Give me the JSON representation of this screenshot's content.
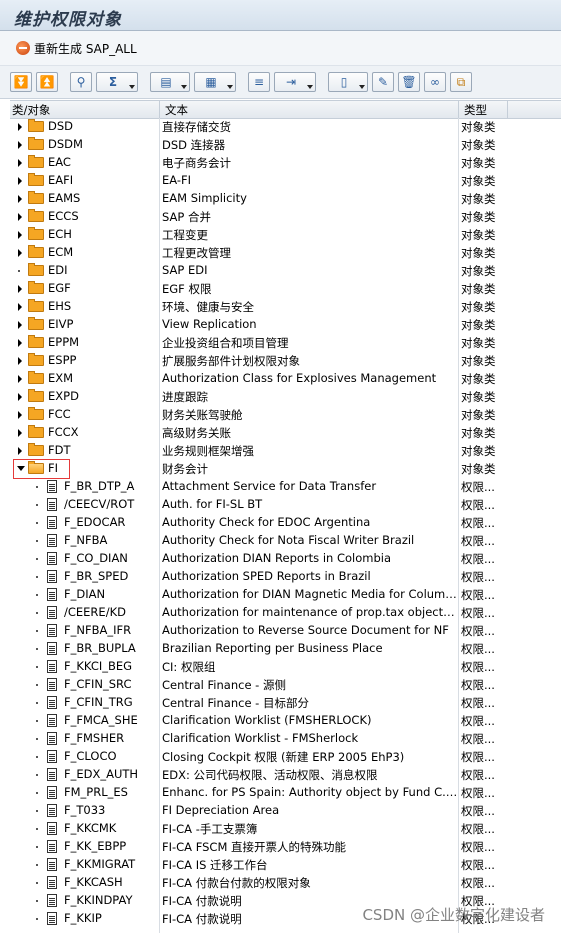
{
  "window": {
    "title": "维护权限对象"
  },
  "app_toolbar": {
    "regenerate_label": "重新生成 SAP_ALL"
  },
  "columns": {
    "object": "类/对象",
    "text": "文本",
    "type": "类型"
  },
  "tree": {
    "classes": [
      {
        "name": "DSD",
        "text": "直接存储交货",
        "type": "对象类",
        "leaf": false
      },
      {
        "name": "DSDM",
        "text": "DSD 连接器",
        "type": "对象类",
        "leaf": false
      },
      {
        "name": "EAC",
        "text": "电子商务会计",
        "type": "对象类",
        "leaf": false
      },
      {
        "name": "EAFI",
        "text": "EA-FI",
        "type": "对象类",
        "leaf": false
      },
      {
        "name": "EAMS",
        "text": "EAM Simplicity",
        "type": "对象类",
        "leaf": false
      },
      {
        "name": "ECCS",
        "text": "SAP 合并",
        "type": "对象类",
        "leaf": false
      },
      {
        "name": "ECH",
        "text": "工程变更",
        "type": "对象类",
        "leaf": false
      },
      {
        "name": "ECM",
        "text": "工程更改管理",
        "type": "对象类",
        "leaf": false
      },
      {
        "name": "EDI",
        "text": "SAP EDI",
        "type": "对象类",
        "leaf": true
      },
      {
        "name": "EGF",
        "text": "EGF 权限",
        "type": "对象类",
        "leaf": false
      },
      {
        "name": "EHS",
        "text": "环境、健康与安全",
        "type": "对象类",
        "leaf": false
      },
      {
        "name": "EIVP",
        "text": "View Replication",
        "type": "对象类",
        "leaf": false
      },
      {
        "name": "EPPM",
        "text": "企业投资组合和项目管理",
        "type": "对象类",
        "leaf": false
      },
      {
        "name": "ESPP",
        "text": "扩展服务部件计划权限对象",
        "type": "对象类",
        "leaf": false
      },
      {
        "name": "EXM",
        "text": "Authorization Class for Explosives Management",
        "type": "对象类",
        "leaf": false
      },
      {
        "name": "EXPD",
        "text": "进度跟踪",
        "type": "对象类",
        "leaf": false
      },
      {
        "name": "FCC",
        "text": "财务关账驾驶舱",
        "type": "对象类",
        "leaf": false
      },
      {
        "name": "FCCX",
        "text": "高级财务关账",
        "type": "对象类",
        "leaf": false
      },
      {
        "name": "FDT",
        "text": "业务规则框架增强",
        "type": "对象类",
        "leaf": false
      },
      {
        "name": "FI",
        "text": "财务会计",
        "type": "对象类",
        "leaf": false,
        "expanded": true
      }
    ],
    "fi_objects": [
      {
        "name": "F_BR_DTP_A",
        "text": "Attachment Service for Data Transfer",
        "type": "权限..."
      },
      {
        "name": "/CEECV/ROT",
        "text": "Auth. for FI-SL BT",
        "type": "权限..."
      },
      {
        "name": "F_EDOCAR",
        "text": "Authority Check for EDOC Argentina",
        "type": "权限..."
      },
      {
        "name": "F_NFBA",
        "text": "Authority Check for Nota Fiscal Writer Brazil",
        "type": "权限..."
      },
      {
        "name": "F_CO_DIAN",
        "text": "Authorization DIAN Reports in Colombia",
        "type": "权限..."
      },
      {
        "name": "F_BR_SPED",
        "text": "Authorization SPED Reports in Brazil",
        "type": "权限..."
      },
      {
        "name": "F_DIAN",
        "text": "Authorization for DIAN Magnetic Media for Columbia",
        "type": "权限..."
      },
      {
        "name": "/CEERE/KD",
        "text": "Authorization for maintenance of prop.tax object m...",
        "type": "权限..."
      },
      {
        "name": "F_NFBA_IFR",
        "text": "Authorization to Reverse Source Document for NF",
        "type": "权限..."
      },
      {
        "name": "F_BR_BUPLA",
        "text": "Brazilian Reporting per Business Place",
        "type": "权限..."
      },
      {
        "name": "F_KKCI_BEG",
        "text": "CI: 权限组",
        "type": "权限..."
      },
      {
        "name": "F_CFIN_SRC",
        "text": "Central Finance - 源侧",
        "type": "权限..."
      },
      {
        "name": "F_CFIN_TRG",
        "text": "Central Finance - 目标部分",
        "type": "权限..."
      },
      {
        "name": "F_FMCA_SHE",
        "text": "Clarification Worklist (FMSHERLOCK)",
        "type": "权限..."
      },
      {
        "name": "F_FMSHER",
        "text": "Clarification Worklist - FMSherlock",
        "type": "权限..."
      },
      {
        "name": "F_CLOCO",
        "text": "Closing Cockpit 权限 (新建 ERP 2005 EhP3)",
        "type": "权限..."
      },
      {
        "name": "F_EDX_AUTH",
        "text": "EDX: 公司代码权限、活动权限、消息权限",
        "type": "权限..."
      },
      {
        "name": "FM_PRL_ES",
        "text": "Enhanc. for PS Spain: Authority object by Fund C. ...",
        "type": "权限..."
      },
      {
        "name": "F_T033",
        "text": "FI Depreciation Area",
        "type": "权限..."
      },
      {
        "name": "F_KKCMK",
        "text": "FI-CA -手工支票簿",
        "type": "权限..."
      },
      {
        "name": "F_KK_EBPP",
        "text": "FI-CA FSCM 直接开票人的特殊功能",
        "type": "权限..."
      },
      {
        "name": "F_KKMIGRAT",
        "text": "FI-CA IS 迁移工作台",
        "type": "权限..."
      },
      {
        "name": "F_KKCASH",
        "text": "FI-CA 付款台付款的权限对象",
        "type": "权限..."
      },
      {
        "name": "F_KKINDPAY",
        "text": "FI-CA 付款说明",
        "type": "权限..."
      },
      {
        "name": "F_KKIP",
        "text": "FI-CA 付款说明",
        "type": "权限..."
      }
    ]
  },
  "watermark": "CSDN @企业数字化建设者"
}
